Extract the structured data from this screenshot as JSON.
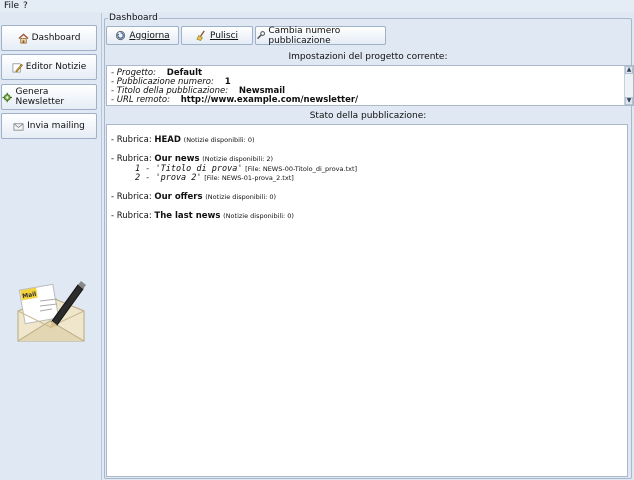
{
  "menu": {
    "file": "File",
    "help": "?"
  },
  "sidebar": {
    "items": [
      {
        "label": "Dashboard",
        "icon": "home-icon"
      },
      {
        "label": "Editor Notizie",
        "icon": "pencil-icon"
      },
      {
        "label": "Genera Newsletter",
        "icon": "gear-icon"
      },
      {
        "label": "Invia mailing",
        "icon": "mail-icon"
      }
    ],
    "logo": "Mail"
  },
  "dashboard": {
    "title": "Dashboard",
    "toolbar": {
      "refresh_label": "Aggiorna",
      "clean_label": "Pulisci",
      "change_number_label": "Cambia numero pubblicazione"
    },
    "settings_heading": "Impostazioni del progetto corrente:",
    "settings": [
      {
        "key": "- Progetto:",
        "value": "Default"
      },
      {
        "key": "- Pubblicazione numero:",
        "value": "1"
      },
      {
        "key": "- Titolo della pubblicazione:",
        "value": "Newsmail"
      },
      {
        "key": "- URL remoto:",
        "value": "http://www.example.com/newsletter/"
      }
    ],
    "status_heading": "Stato della pubblicazione:",
    "rubriche": [
      {
        "prefix": "- Rubrica:",
        "name": "HEAD",
        "count": "(Notizie disponibili: 0)",
        "news": []
      },
      {
        "prefix": "- Rubrica:",
        "name": "Our news",
        "count": "(Notizie disponibili: 2)",
        "news": [
          {
            "text": "1 - 'Titolo di prova'",
            "file": "[File: NEWS-00-Titolo_di_prova.txt]"
          },
          {
            "text": "2 - 'prova 2'",
            "file": "[File: NEWS-01-prova_2.txt]"
          }
        ]
      },
      {
        "prefix": "- Rubrica:",
        "name": "Our offers",
        "count": "(Notizie disponibili: 0)",
        "news": []
      },
      {
        "prefix": "- Rubrica:",
        "name": "The last news",
        "count": "(Notizie disponibili: 0)",
        "news": []
      }
    ]
  }
}
